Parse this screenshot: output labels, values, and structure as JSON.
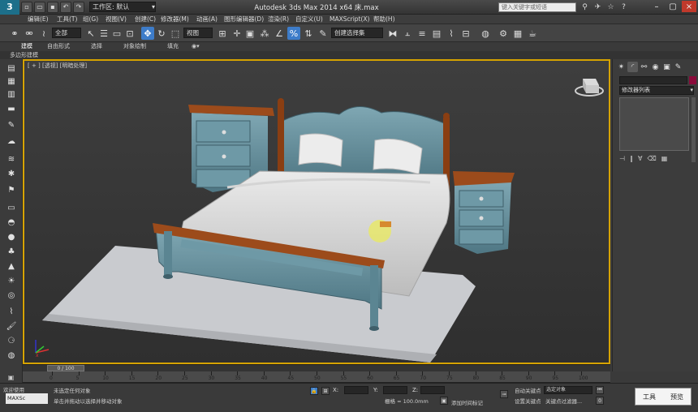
{
  "titlebar": {
    "logo": "3",
    "workspace_label": "工作区: 默认",
    "window_title": "Autodesk 3ds Max 2014 x64   床.max",
    "search_placeholder": "键入关键字或短语",
    "minimize": "–",
    "restore": "▢",
    "close": "×"
  },
  "menu": [
    "编辑(E)",
    "工具(T)",
    "组(G)",
    "视图(V)",
    "创建(C)",
    "修改器(M)",
    "动画(A)",
    "图形编辑器(D)",
    "渲染(R)",
    "自定义(U)",
    "MAXScript(X)",
    "帮助(H)"
  ],
  "toolbar": {
    "selection_filter": "全部",
    "reference_coord": "视图",
    "named_selection": "创建选择集"
  },
  "ribbon": {
    "tabs": [
      "建模",
      "自由形式",
      "选择",
      "对象绘制",
      "填充"
    ],
    "sub_label": "多边形建模"
  },
  "viewport": {
    "label": "[ + ] [透视] [明暗处理]",
    "axis_label": "x"
  },
  "command_panel": {
    "modifier_list": "修改器列表"
  },
  "time_slider": {
    "position": "0 / 100"
  },
  "trackbar_ticks": [
    "0",
    "5",
    "10",
    "15",
    "20",
    "25",
    "30",
    "35",
    "40",
    "45",
    "50",
    "55",
    "60",
    "65",
    "70",
    "75",
    "80",
    "85",
    "90",
    "95",
    "100"
  ],
  "status": {
    "selection_set": "欢迎使用",
    "ruler_value": "MAXSc",
    "prompt_top": "未选定任何对象",
    "prompt_bottom": "单击并拖动以选择并移动对象",
    "x_label": "X:",
    "y_label": "Y:",
    "z_label": "Z:",
    "grid": "栅格 = 100.0mm",
    "add_time_tag": "添加时间标记",
    "auto_key": "自动关键点",
    "set_key": "设置关键点",
    "selected_object": "选定对象",
    "key_filters": "关键点过滤器..."
  },
  "popup": {
    "tools": "工具",
    "preview": "预览"
  }
}
